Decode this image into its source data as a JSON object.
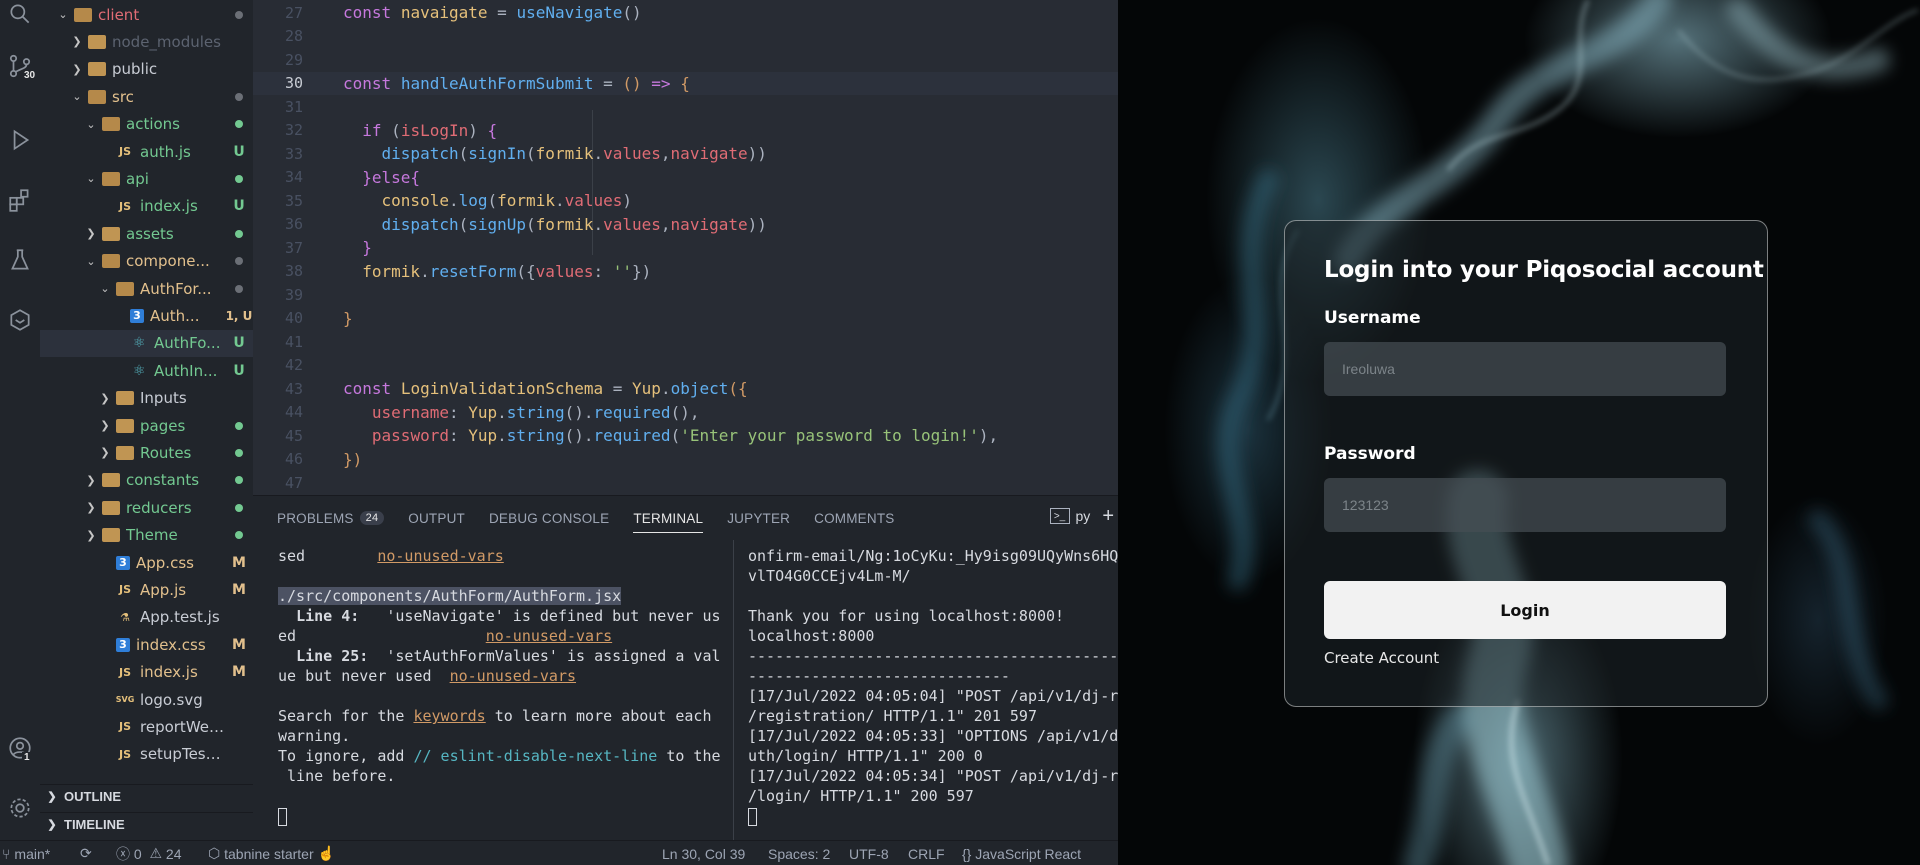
{
  "activity_bar": {
    "scm_badge": "30",
    "account_badge": "1",
    "icons": [
      "search-icon",
      "source-control-icon",
      "run-debug-icon",
      "extensions-icon",
      "testing-icon",
      "remote-icon",
      "account-icon",
      "settings-gear-icon"
    ]
  },
  "explorer": {
    "items": [
      {
        "name": "client",
        "status": "",
        "color": "#e06c75"
      },
      {
        "name": "node_modules",
        "status": "",
        "color": "#5c6370"
      },
      {
        "name": "public",
        "status": "",
        "color": "#c8ccd4"
      },
      {
        "name": "src",
        "status": "",
        "color": "#e2c08d"
      },
      {
        "name": "actions",
        "status": "",
        "color": "#73c991"
      },
      {
        "name": "auth.js",
        "status": "U",
        "color": "#73c991",
        "icon": "JS"
      },
      {
        "name": "api",
        "status": "",
        "color": "#73c991"
      },
      {
        "name": "index.js",
        "status": "U",
        "color": "#73c991",
        "icon": "JS"
      },
      {
        "name": "assets",
        "status": "",
        "color": "#73c991"
      },
      {
        "name": "compone...",
        "status": "",
        "color": "#e2c08d"
      },
      {
        "name": "AuthFor...",
        "status": "",
        "color": "#e2c08d"
      },
      {
        "name": "Auth...",
        "status": "1, U",
        "color": "#e2c08d"
      },
      {
        "name": "AuthFo...",
        "status": "U",
        "color": "#73c991"
      },
      {
        "name": "AuthIn...",
        "status": "U",
        "color": "#73c991"
      },
      {
        "name": "Inputs",
        "status": "",
        "color": "#c8ccd4"
      },
      {
        "name": "pages",
        "status": "",
        "color": "#73c991"
      },
      {
        "name": "Routes",
        "status": "",
        "color": "#73c991"
      },
      {
        "name": "constants",
        "status": "",
        "color": "#73c991"
      },
      {
        "name": "reducers",
        "status": "",
        "color": "#73c991"
      },
      {
        "name": "Theme",
        "status": "",
        "color": "#73c991"
      },
      {
        "name": "App.css",
        "status": "M",
        "color": "#e2c08d"
      },
      {
        "name": "App.js",
        "status": "M",
        "color": "#e2c08d"
      },
      {
        "name": "App.test.js",
        "status": "",
        "color": "#c8ccd4"
      },
      {
        "name": "index.css",
        "status": "M",
        "color": "#e2c08d"
      },
      {
        "name": "index.js",
        "status": "M",
        "color": "#e2c08d"
      },
      {
        "name": "logo.svg",
        "status": "",
        "color": "#c8ccd4"
      },
      {
        "name": "reportWebVital...",
        "status": "",
        "color": "#c8ccd4"
      },
      {
        "name": "setupTests.js",
        "status": "",
        "color": "#c8ccd4"
      }
    ],
    "outline_label": "OUTLINE",
    "timeline_label": "TIMELINE"
  },
  "editor": {
    "current_line": "30"
  },
  "panel": {
    "tabs": [
      "PROBLEMS",
      "OUTPUT",
      "DEBUG CONSOLE",
      "TERMINAL",
      "JUPYTER",
      "COMMENTS"
    ],
    "problems_count": "24",
    "active_tab": "TERMINAL",
    "terminal_name": "py"
  },
  "statusbar": {
    "branch": "main*",
    "errors": "0",
    "warnings": "24",
    "tabnine": "tabnine starter",
    "position": "Ln 30, Col 39",
    "spaces": "Spaces: 2",
    "encoding": "UTF-8",
    "eol": "CRLF",
    "language": "JavaScript React"
  },
  "login": {
    "title": "Login into your Piqosocial account",
    "username_label": "Username",
    "username_placeholder": "Ireoluwa",
    "password_label": "Password",
    "password_placeholder": "123123",
    "button_label": "Login",
    "create_account": "Create Account"
  }
}
